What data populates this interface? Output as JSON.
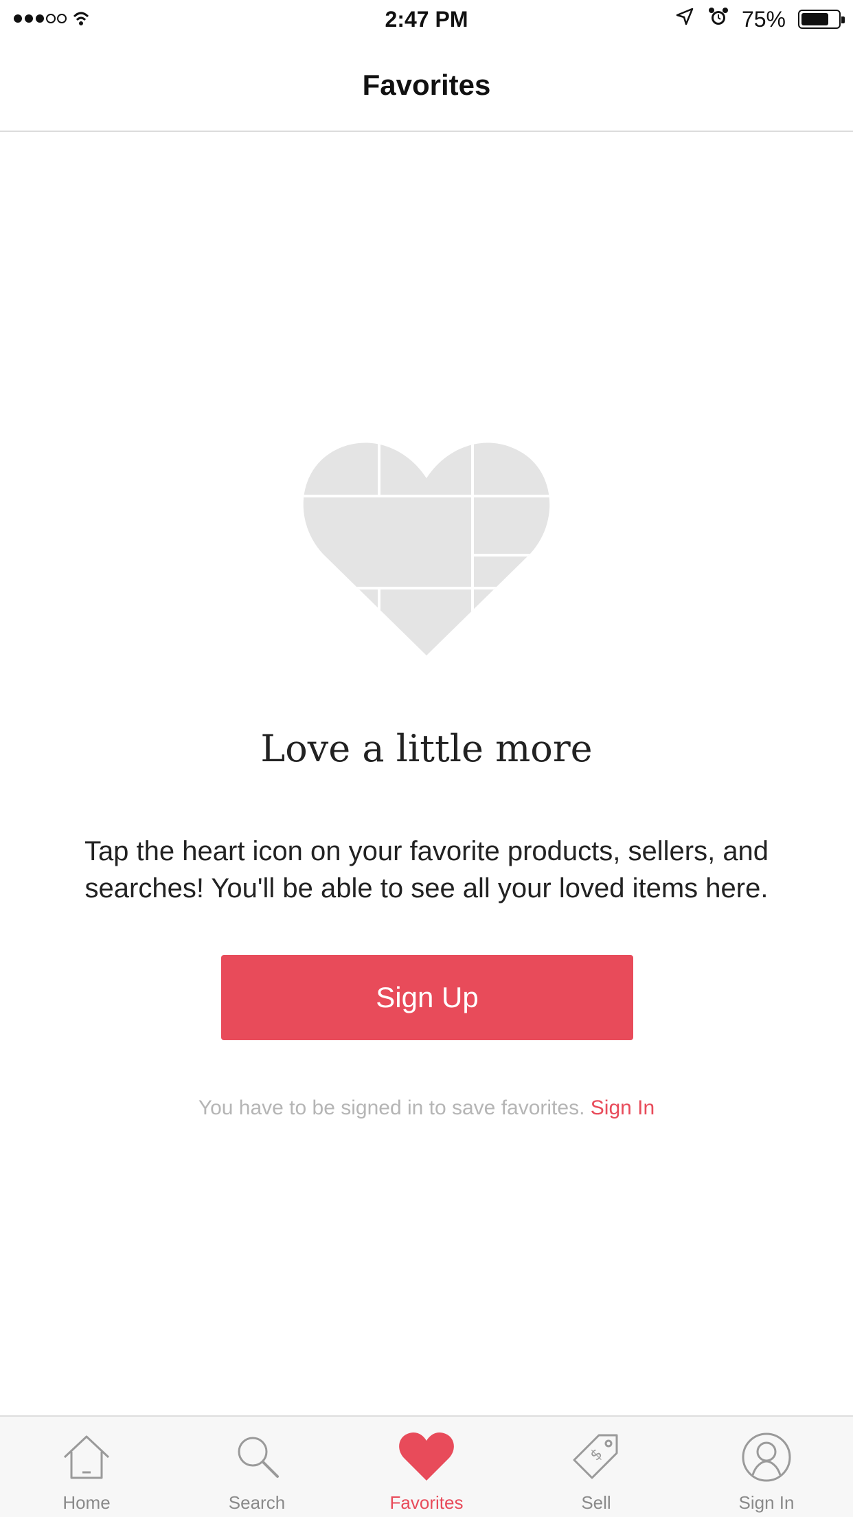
{
  "status_bar": {
    "time": "2:47 PM",
    "battery": "75%",
    "battery_level": 0.75
  },
  "header": {
    "title": "Favorites"
  },
  "empty_state": {
    "headline": "Love a little more",
    "description": "Tap the heart icon on your favorite products, sellers, and searches! You'll be able to see all your loved items here.",
    "image_icon": "heart-collage-icon"
  },
  "signup": {
    "button_label": "Sign Up",
    "note": "You have to be signed in to save favorites.",
    "signin_link": "Sign In"
  },
  "tabs": [
    {
      "label": "Home",
      "icon": "home-icon",
      "active": false
    },
    {
      "label": "Search",
      "icon": "search-icon",
      "active": false
    },
    {
      "label": "Favorites",
      "icon": "heart-icon",
      "active": true
    },
    {
      "label": "Sell",
      "icon": "price-tag-icon",
      "active": false
    },
    {
      "label": "Sign In",
      "icon": "user-icon",
      "active": false
    }
  ],
  "colors": {
    "accent": "#e84b5a",
    "inactive_icon": "#9a9a9a",
    "heart_placeholder": "#e4e4e4"
  }
}
